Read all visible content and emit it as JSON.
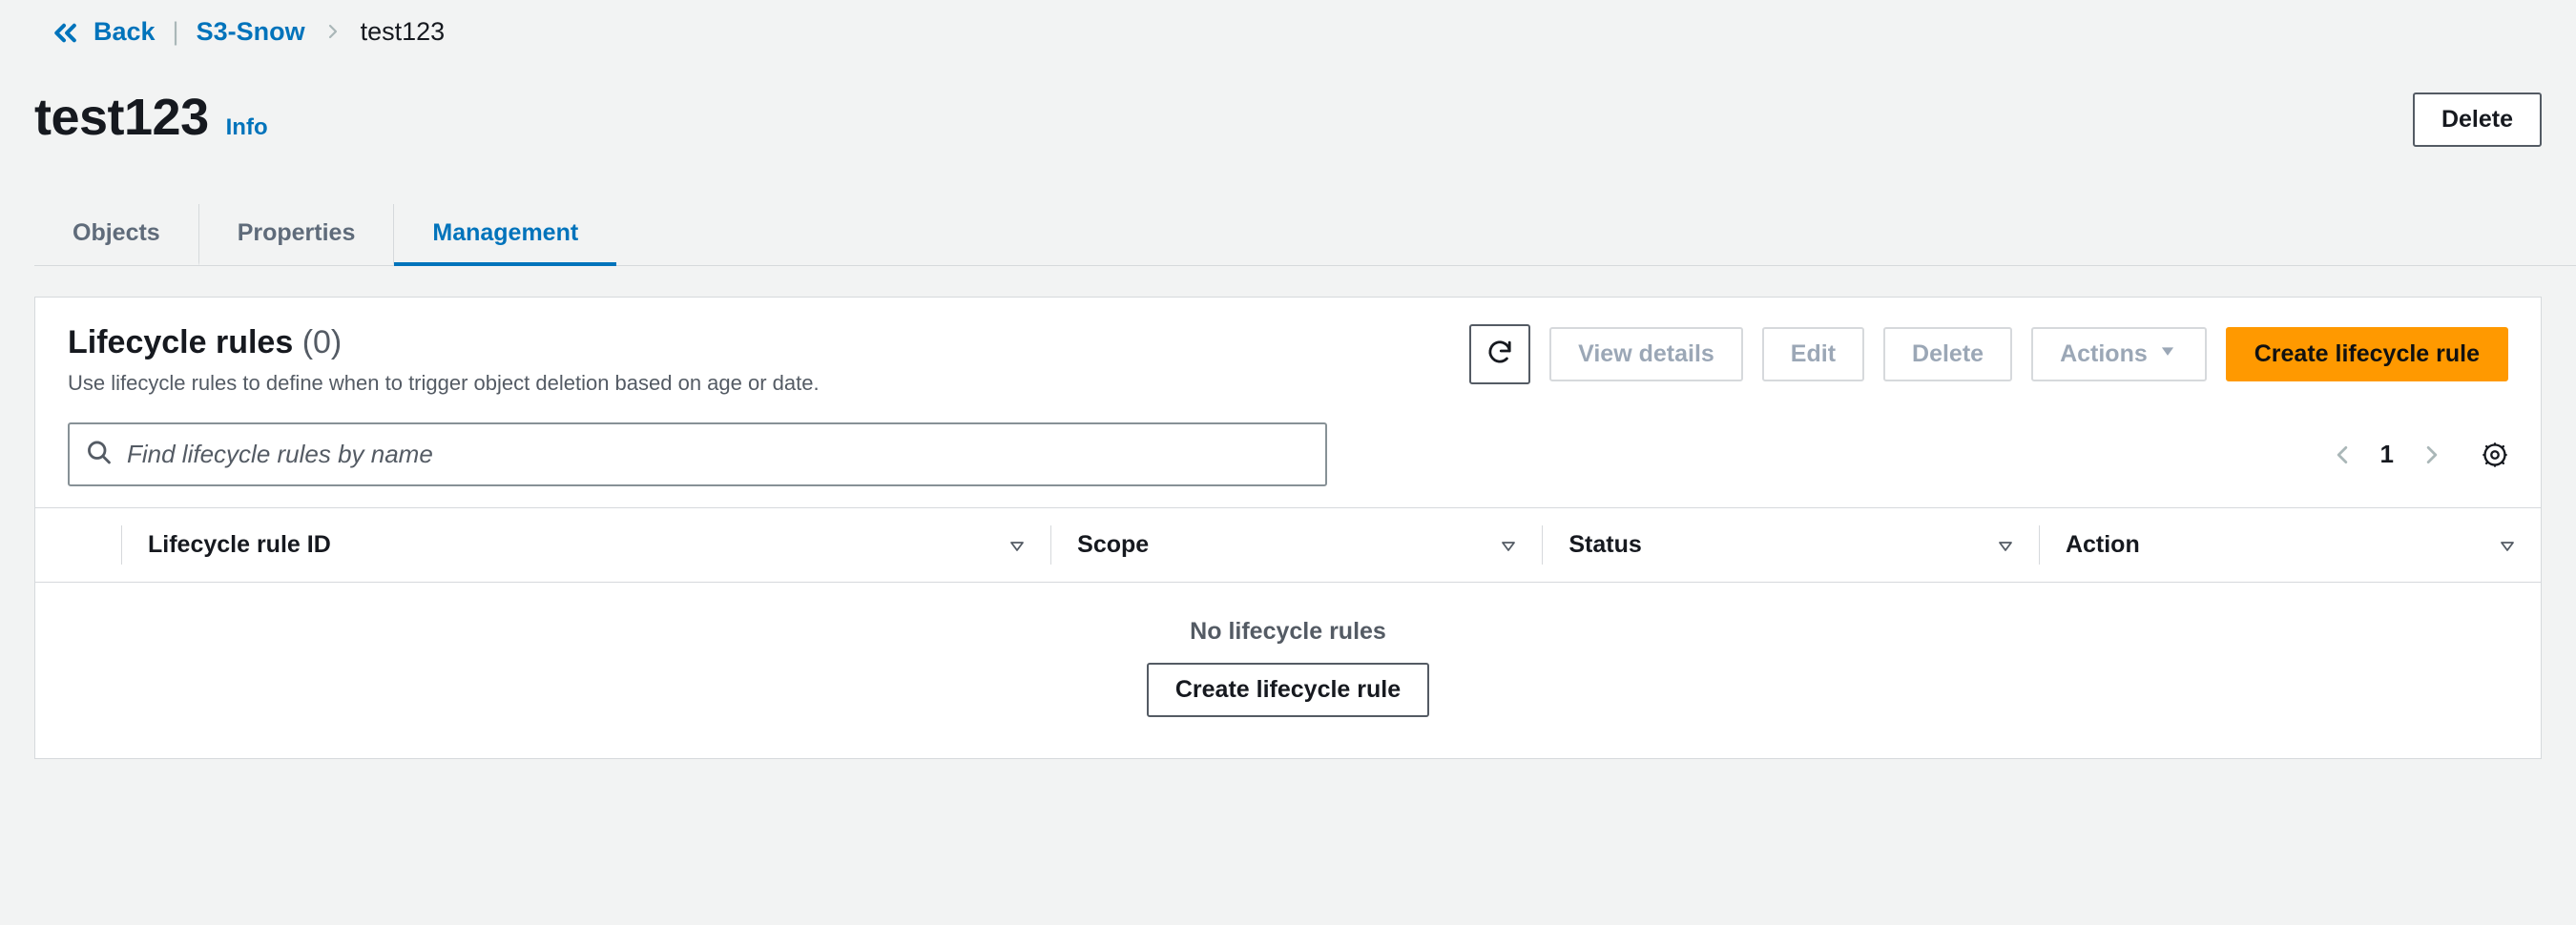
{
  "breadcrumb": {
    "back_label": "Back",
    "root_label": "S3-Snow",
    "current": "test123"
  },
  "header": {
    "title": "test123",
    "info_label": "Info",
    "delete_label": "Delete"
  },
  "tabs": [
    {
      "id": "objects",
      "label": "Objects",
      "active": false
    },
    {
      "id": "properties",
      "label": "Properties",
      "active": false
    },
    {
      "id": "management",
      "label": "Management",
      "active": true
    }
  ],
  "panel": {
    "title": "Lifecycle rules",
    "count_display": "(0)",
    "description": "Use lifecycle rules to define when to trigger object deletion based on age or date.",
    "buttons": {
      "refresh_aria": "Refresh",
      "view_details": "View details",
      "edit": "Edit",
      "delete": "Delete",
      "actions": "Actions",
      "create": "Create lifecycle rule"
    },
    "search": {
      "placeholder": "Find lifecycle rules by name",
      "value": ""
    },
    "pagination": {
      "page": "1"
    },
    "columns": [
      {
        "id": "rule_id",
        "label": "Lifecycle rule ID"
      },
      {
        "id": "scope",
        "label": "Scope"
      },
      {
        "id": "status",
        "label": "Status"
      },
      {
        "id": "action",
        "label": "Action"
      }
    ],
    "empty": {
      "title": "No lifecycle rules",
      "button": "Create lifecycle rule"
    },
    "rows": []
  }
}
